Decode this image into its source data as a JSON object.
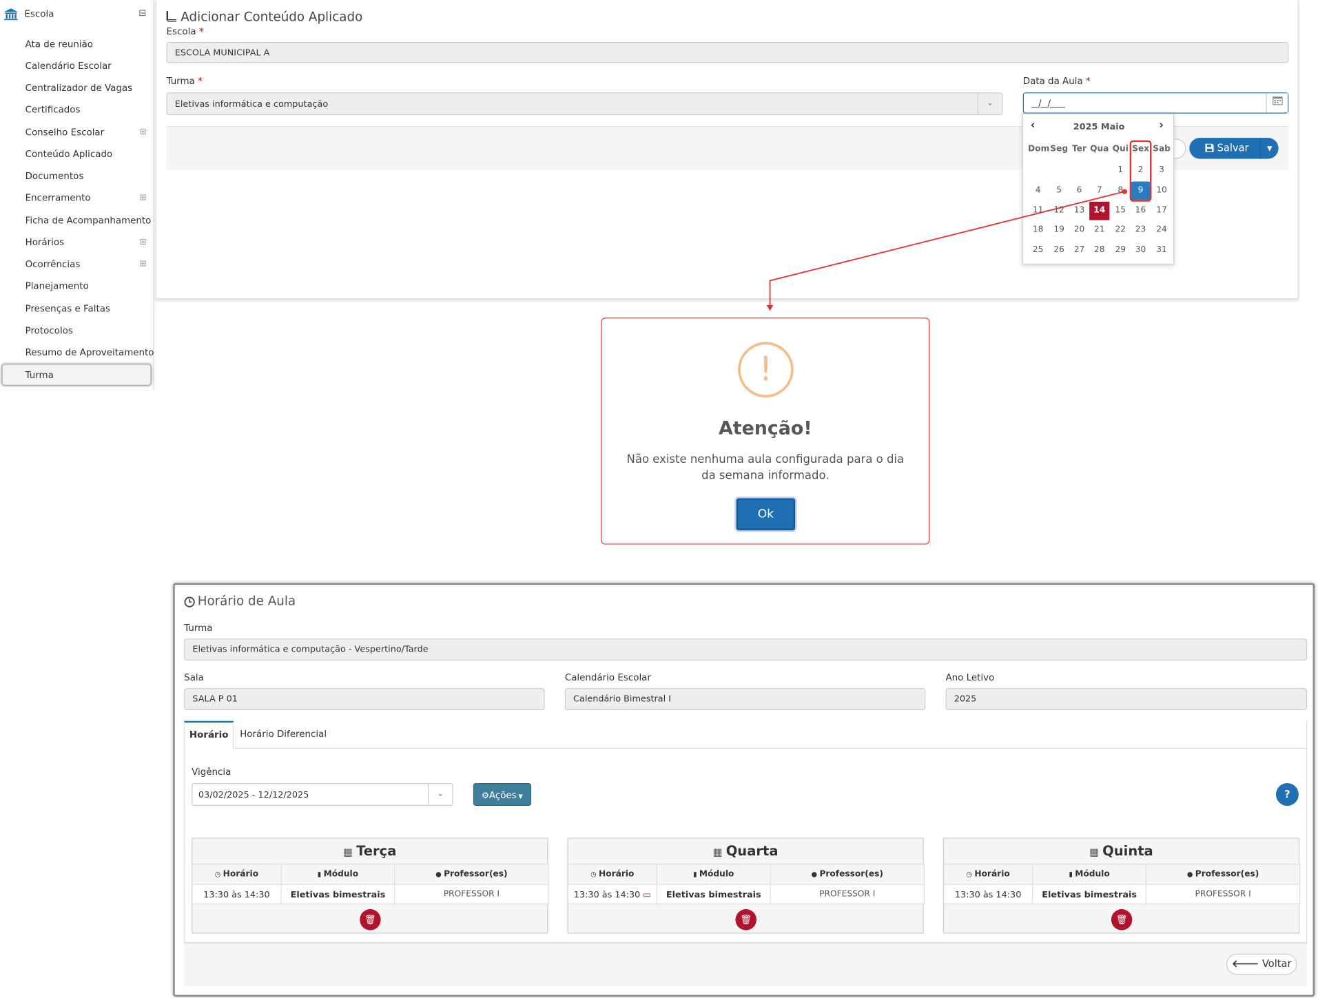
{
  "sidebar": {
    "header": "Escola",
    "items": [
      {
        "label": "Ata de reunião"
      },
      {
        "label": "Calendário Escolar"
      },
      {
        "label": "Centralizador de Vagas"
      },
      {
        "label": "Certificados"
      },
      {
        "label": "Conselho Escolar",
        "expand": "⊞"
      },
      {
        "label": "Conteúdo Aplicado"
      },
      {
        "label": "Documentos"
      },
      {
        "label": "Encerramento",
        "expand": "⊞"
      },
      {
        "label": "Ficha de Acompanhamento"
      },
      {
        "label": "Horários",
        "expand": "⊞"
      },
      {
        "label": "Ocorrências",
        "expand": "⊞"
      },
      {
        "label": "Planejamento"
      },
      {
        "label": "Presenças e Faltas"
      },
      {
        "label": "Protocolos"
      },
      {
        "label": "Resumo de Aproveitamento"
      },
      {
        "label": "Turma"
      }
    ],
    "collapse": "⊟"
  },
  "form": {
    "title": "Adicionar Conteúdo Aplicado",
    "escola_label": "Escola",
    "escola_value": "ESCOLA MUNICIPAL A",
    "turma_label": "Turma",
    "turma_value": "Eletivas informática e computação",
    "data_label": "Data da Aula",
    "data_value": "__/__/____",
    "required": "*",
    "save_label": "Salvar"
  },
  "datepicker": {
    "title": "2025 Maio",
    "weekdays": [
      "Dom",
      "Seg",
      "Ter",
      "Qua",
      "Qui",
      "Sex",
      "Sab"
    ],
    "weeks": [
      [
        "",
        "",
        "",
        "",
        "1",
        "2",
        "3"
      ],
      [
        "4",
        "5",
        "6",
        "7",
        "8",
        "9",
        "10"
      ],
      [
        "11",
        "12",
        "13",
        "14",
        "15",
        "16",
        "17"
      ],
      [
        "18",
        "19",
        "20",
        "21",
        "22",
        "23",
        "24"
      ],
      [
        "25",
        "26",
        "27",
        "28",
        "29",
        "30",
        "31"
      ]
    ],
    "selected": "9",
    "today": "14"
  },
  "modal": {
    "icon": "!",
    "title": "Atenção!",
    "message_line1": "Não existe nenhuma aula configurada para o dia",
    "message_line2": "da semana informado.",
    "ok_label": "Ok"
  },
  "schedule": {
    "title": "Horário de Aula",
    "turma_label": "Turma",
    "turma_value": "Eletivas informática e computação - Vespertino/Tarde",
    "sala_label": "Sala",
    "sala_value": "SALA P 01",
    "calendario_label": "Calendário Escolar",
    "calendario_value": "Calendário Bimestral I",
    "ano_label": "Ano Letivo",
    "ano_value": "2025",
    "tabs": [
      {
        "label": "Horário"
      },
      {
        "label": "Horário Diferencial"
      }
    ],
    "vigencia_label": "Vigência",
    "vigencia_value": "03/02/2025 - 12/12/2025",
    "acoes_label": "Ações",
    "col_horario": "Horário",
    "col_modulo": "Módulo",
    "col_professor": "Professor(es)",
    "days": [
      {
        "name": "Terça",
        "horario": "13:30 às 14:30",
        "modulo": "Eletivas bimestrais",
        "professor": "PROFESSOR I"
      },
      {
        "name": "Quarta",
        "horario": "13:30 às 14:30",
        "modulo": "Eletivas bimestrais",
        "professor": "PROFESSOR I"
      },
      {
        "name": "Quinta",
        "horario": "13:30 às 14:30",
        "modulo": "Eletivas bimestrais",
        "professor": "PROFESSOR I"
      }
    ],
    "voltar_label": "Voltar"
  },
  "colors": {
    "primary": "#1f6fb2",
    "danger": "#b3122e",
    "annotation": "#e33333",
    "warning": "#f8bb86"
  }
}
